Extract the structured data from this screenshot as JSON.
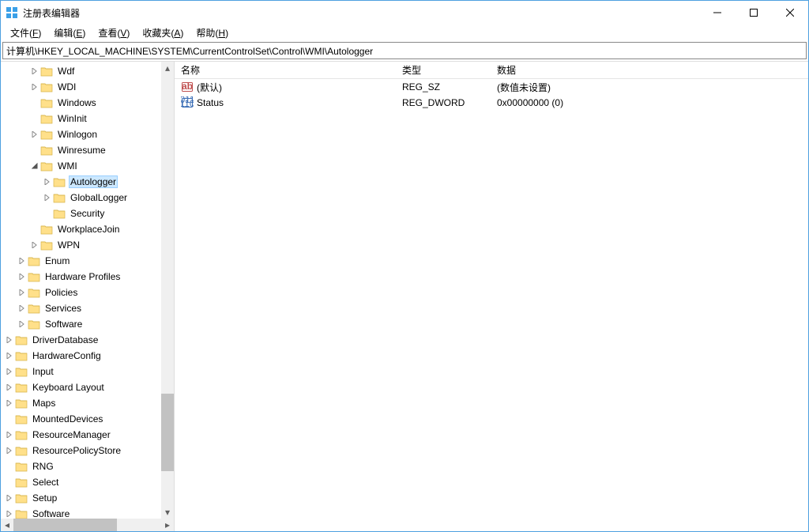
{
  "title": "注册表编辑器",
  "menu": {
    "file": "文件(F)",
    "edit": "编辑(E)",
    "view": "查看(V)",
    "fav": "收藏夹(A)",
    "help": "帮助(H)"
  },
  "address": "计算机\\HKEY_LOCAL_MACHINE\\SYSTEM\\CurrentControlSet\\Control\\WMI\\Autologger",
  "columns": {
    "name": "名称",
    "type": "类型",
    "data": "数据"
  },
  "tree": [
    {
      "indent": 2,
      "exp": ">",
      "label": "Wdf"
    },
    {
      "indent": 2,
      "exp": ">",
      "label": "WDI"
    },
    {
      "indent": 2,
      "exp": "",
      "label": "Windows"
    },
    {
      "indent": 2,
      "exp": "",
      "label": "WinInit"
    },
    {
      "indent": 2,
      "exp": ">",
      "label": "Winlogon"
    },
    {
      "indent": 2,
      "exp": "",
      "label": "Winresume"
    },
    {
      "indent": 2,
      "exp": "v",
      "label": "WMI"
    },
    {
      "indent": 3,
      "exp": ">",
      "label": "Autologger",
      "selected": true
    },
    {
      "indent": 3,
      "exp": ">",
      "label": "GlobalLogger"
    },
    {
      "indent": 3,
      "exp": "",
      "label": "Security"
    },
    {
      "indent": 2,
      "exp": "",
      "label": "WorkplaceJoin"
    },
    {
      "indent": 2,
      "exp": ">",
      "label": "WPN"
    },
    {
      "indent": 1,
      "exp": ">",
      "label": "Enum"
    },
    {
      "indent": 1,
      "exp": ">",
      "label": "Hardware Profiles"
    },
    {
      "indent": 1,
      "exp": ">",
      "label": "Policies"
    },
    {
      "indent": 1,
      "exp": ">",
      "label": "Services"
    },
    {
      "indent": 1,
      "exp": ">",
      "label": "Software"
    },
    {
      "indent": 0,
      "exp": ">",
      "label": "DriverDatabase"
    },
    {
      "indent": 0,
      "exp": ">",
      "label": "HardwareConfig"
    },
    {
      "indent": 0,
      "exp": ">",
      "label": "Input"
    },
    {
      "indent": 0,
      "exp": ">",
      "label": "Keyboard Layout"
    },
    {
      "indent": 0,
      "exp": ">",
      "label": "Maps"
    },
    {
      "indent": 0,
      "exp": "",
      "label": "MountedDevices"
    },
    {
      "indent": 0,
      "exp": ">",
      "label": "ResourceManager"
    },
    {
      "indent": 0,
      "exp": ">",
      "label": "ResourcePolicyStore"
    },
    {
      "indent": 0,
      "exp": "",
      "label": "RNG"
    },
    {
      "indent": 0,
      "exp": "",
      "label": "Select"
    },
    {
      "indent": 0,
      "exp": ">",
      "label": "Setup"
    },
    {
      "indent": 0,
      "exp": ">",
      "label": "Software"
    }
  ],
  "values": [
    {
      "icon": "string",
      "name": "(默认)",
      "type": "REG_SZ",
      "data": "(数值未设置)"
    },
    {
      "icon": "binary",
      "name": "Status",
      "type": "REG_DWORD",
      "data": "0x00000000 (0)"
    }
  ]
}
